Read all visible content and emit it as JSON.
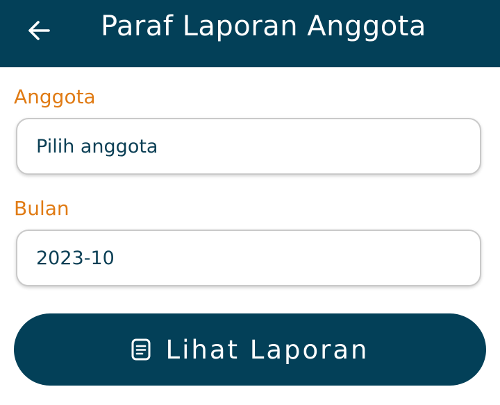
{
  "header": {
    "title": "Paraf Laporan Anggota",
    "back_icon": "arrow-left-icon",
    "background": "#034058"
  },
  "form": {
    "member": {
      "label": "Anggota",
      "value": "Pilih anggota"
    },
    "month": {
      "label": "Bulan",
      "value": "2023-10"
    }
  },
  "action": {
    "label": "Lihat Laporan",
    "icon": "document-icon"
  },
  "colors": {
    "primary": "#034058",
    "label_accent": "#e07b14",
    "input_text": "#0b3f55"
  }
}
